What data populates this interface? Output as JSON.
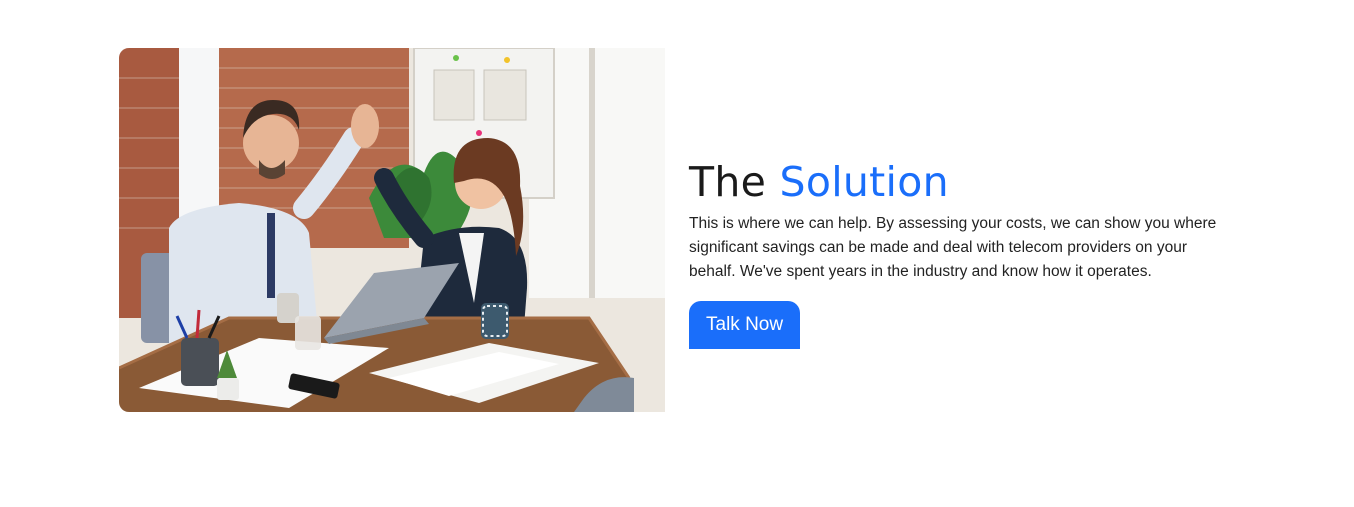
{
  "solution": {
    "title_prefix": "The",
    "title_accent": "Solution",
    "body": "This is where we can help. By assessing your costs, we can show you where significant savings can be made and deal with telecom providers on your behalf. We've spent years in the industry and know how it operates.",
    "cta_label": "Talk Now",
    "image_icon": "office-high-five-photo"
  },
  "colors": {
    "accent": "#1a6efa",
    "text": "#1a1a1a",
    "background": "#ffffff"
  }
}
